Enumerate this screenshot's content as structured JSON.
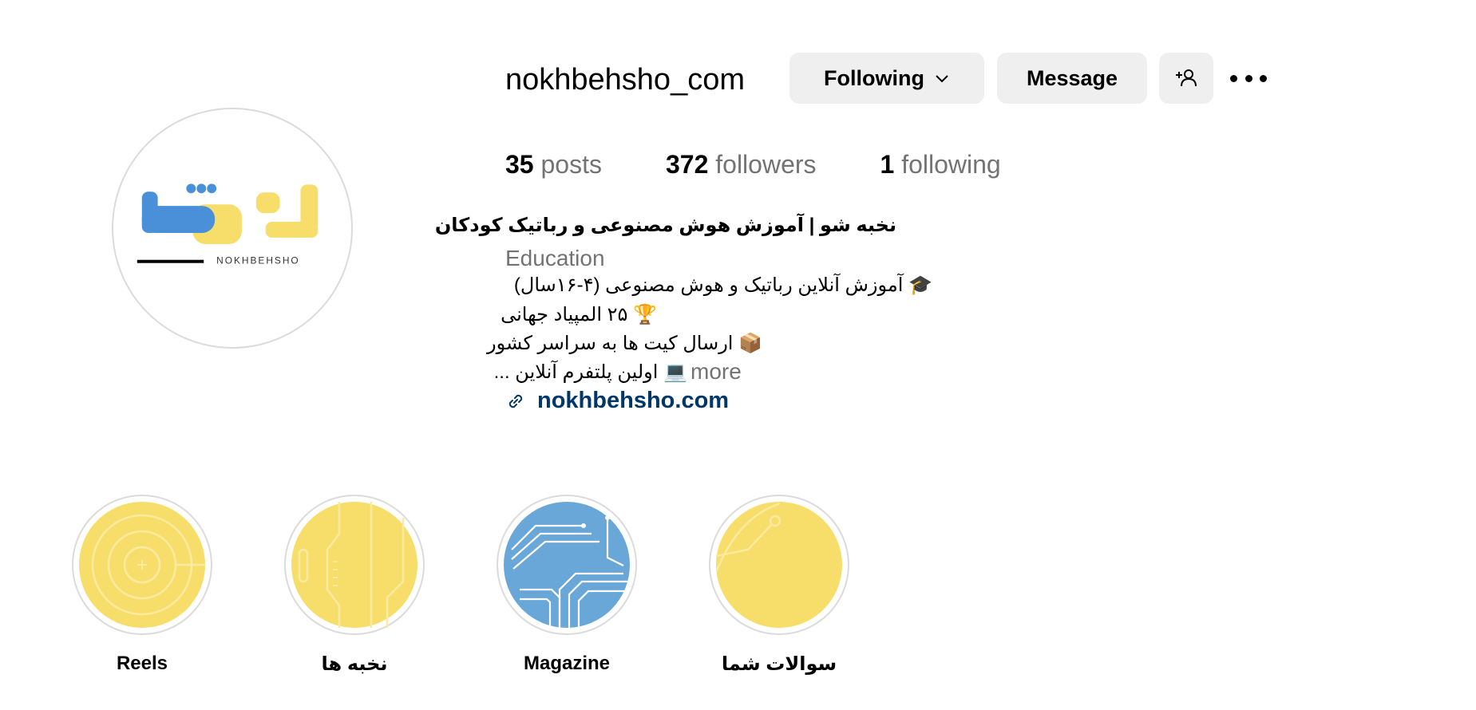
{
  "profile": {
    "username": "nokhbehsho_com",
    "following_label": "Following",
    "message_label": "Message",
    "stats": {
      "posts_count": "35",
      "posts_label": "posts",
      "followers_count": "372",
      "followers_label": "followers",
      "following_count": "1",
      "following_label": "following"
    },
    "bio": {
      "name": "نخبه شو | آموزش هوش مصنوعی و رباتیک کودکان",
      "category": "Education",
      "lines": [
        "🎓 آموزش آنلاین رباتیک و  هوش مصنوعی (۴-۱۶سال)",
        "🏆 ۲۵ المپیاد جهانی",
        "📦 ارسال کیت ها به سراسر کشور",
        "💻 اولین پلتفرم آنلاین ..."
      ],
      "more_label": "more",
      "link": "nokhbehsho.com"
    },
    "avatar": {
      "logo_wordmark": "NOKHBEHSHO",
      "brand_blue": "#4a90d9",
      "brand_yellow": "#f7de6a"
    }
  },
  "highlights": [
    {
      "label": "Reels",
      "color": "#f7de6a"
    },
    {
      "label": "نخبه ها",
      "color": "#f7de6a"
    },
    {
      "label": "Magazine",
      "color": "#6aa7d9"
    },
    {
      "label": "سوالات شما",
      "color": "#f7de6a"
    }
  ],
  "icons": {
    "following_dropdown": "chevron-down-icon",
    "add_person": "add-person-icon",
    "more": "more-options-icon",
    "link": "link-icon"
  }
}
